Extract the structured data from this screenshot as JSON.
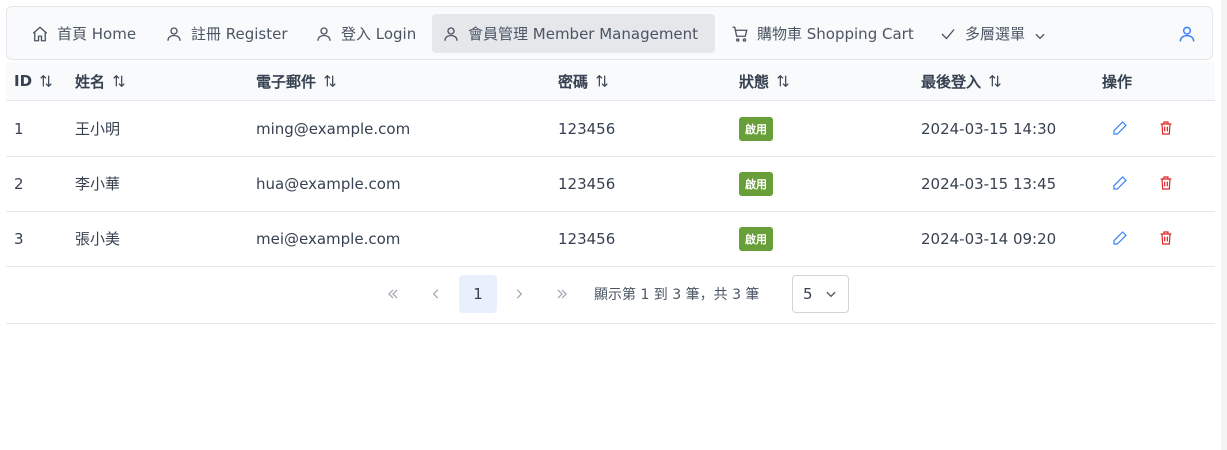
{
  "menu": {
    "items": [
      {
        "label": "首頁 Home",
        "icon": "home-icon"
      },
      {
        "label": "註冊 Register",
        "icon": "user-icon"
      },
      {
        "label": "登入 Login",
        "icon": "user-icon"
      },
      {
        "label": "會員管理 Member Management",
        "icon": "user-icon",
        "active": true
      },
      {
        "label": "購物車 Shopping Cart",
        "icon": "cart-icon"
      },
      {
        "label": "多層選單",
        "icon": "check-icon"
      }
    ],
    "user_icon": "user-icon"
  },
  "table": {
    "columns": [
      "ID",
      "姓名",
      "電子郵件",
      "密碼",
      "狀態",
      "最後登入",
      "操作"
    ],
    "rows": [
      {
        "id": "1",
        "name": "王小明",
        "email": "ming@example.com",
        "password": "123456",
        "status": "啟用",
        "last_login": "2024-03-15 14:30"
      },
      {
        "id": "2",
        "name": "李小華",
        "email": "hua@example.com",
        "password": "123456",
        "status": "啟用",
        "last_login": "2024-03-15 13:45"
      },
      {
        "id": "3",
        "name": "張小美",
        "email": "mei@example.com",
        "password": "123456",
        "status": "啟用",
        "last_login": "2024-03-14 09:20"
      }
    ]
  },
  "paginator": {
    "current_page": "1",
    "info": "顯示第 1 到 3 筆，共 3 筆",
    "rows_per_page": "5"
  },
  "colors": {
    "accent": "#3b82f6",
    "status_active": "#689f38",
    "delete": "#dc2626",
    "edit": "#3b82f6"
  }
}
